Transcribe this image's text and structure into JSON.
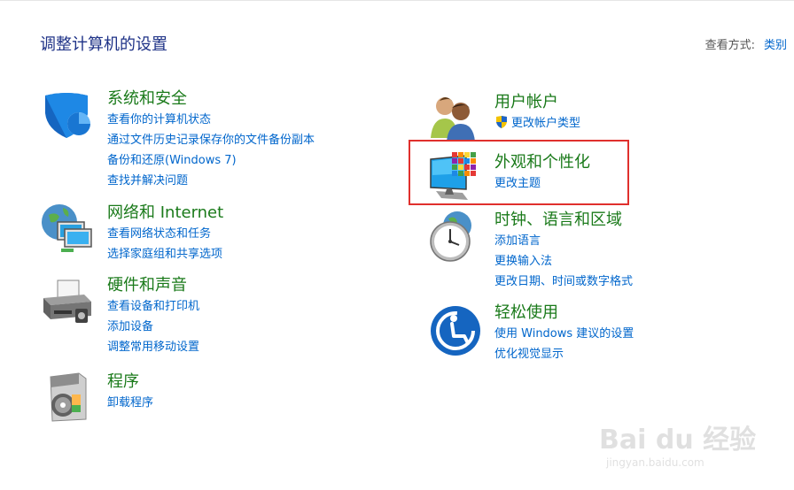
{
  "header": {
    "title": "调整计算机的设置"
  },
  "viewby": {
    "label": "查看方式:",
    "value": "类别"
  },
  "categories": {
    "security": {
      "title": "系统和安全",
      "icon": "shield-icon",
      "links": [
        "查看你的计算机状态",
        "通过文件历史记录保存你的文件备份副本",
        "备份和还原(Windows 7)",
        "查找并解决问题"
      ]
    },
    "network": {
      "title": "网络和 Internet",
      "icon": "globe-network-icon",
      "links": [
        "查看网络状态和任务",
        "选择家庭组和共享选项"
      ]
    },
    "hardware": {
      "title": "硬件和声音",
      "icon": "printer-icon",
      "links": [
        "查看设备和打印机",
        "添加设备",
        "调整常用移动设置"
      ]
    },
    "programs": {
      "title": "程序",
      "icon": "programs-disc-icon",
      "links": [
        "卸载程序"
      ]
    },
    "accounts": {
      "title": "用户帐户",
      "icon": "users-icon",
      "links": [
        "更改帐户类型"
      ]
    },
    "appearance": {
      "title": "外观和个性化",
      "icon": "monitor-palette-icon",
      "links": [
        "更改主题"
      ]
    },
    "clock": {
      "title": "时钟、语言和区域",
      "icon": "clock-globe-icon",
      "links": [
        "添加语言",
        "更换输入法",
        "更改日期、时间或数字格式"
      ]
    },
    "ease": {
      "title": "轻松使用",
      "icon": "ease-of-access-icon",
      "links": [
        "使用 Windows 建议的设置",
        "优化视觉显示"
      ]
    }
  },
  "watermark": {
    "main": "Bai du 经验",
    "sub": "jingyan.baidu.com"
  }
}
